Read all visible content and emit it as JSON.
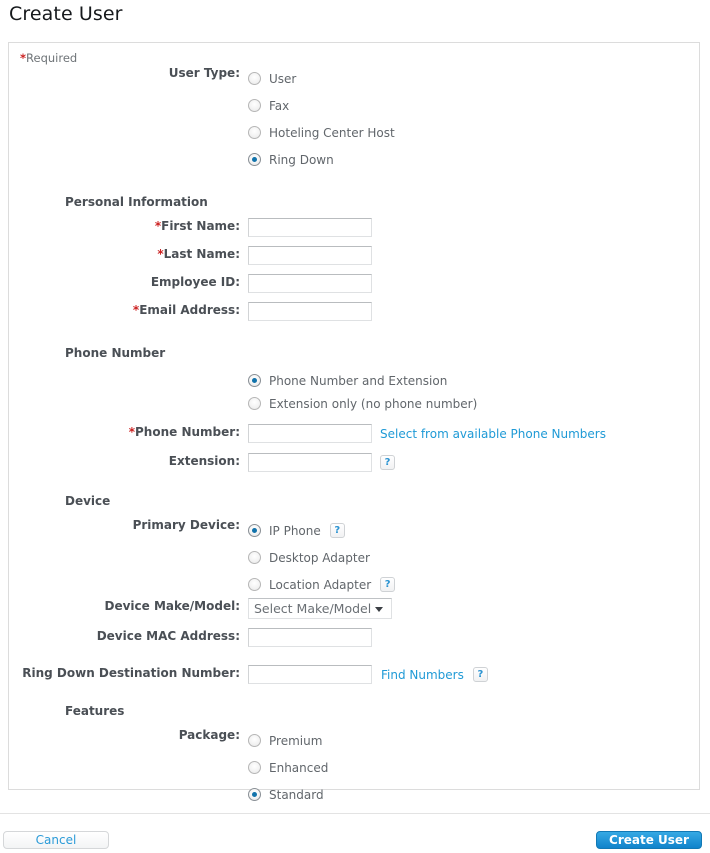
{
  "page": {
    "title": "Create User",
    "required_note_star": "*",
    "required_note_text": "Required"
  },
  "form": {
    "user_type": {
      "label": "User Type:",
      "options": [
        {
          "label": "User",
          "selected": false
        },
        {
          "label": "Fax",
          "selected": false
        },
        {
          "label": "Hoteling Center Host",
          "selected": false
        },
        {
          "label": "Ring Down",
          "selected": true
        }
      ]
    },
    "personal_information": {
      "heading": "Personal Information",
      "first_name": {
        "label": "First Name:",
        "required": true,
        "value": ""
      },
      "last_name": {
        "label": "Last Name:",
        "required": true,
        "value": ""
      },
      "employee_id": {
        "label": "Employee ID:",
        "required": false,
        "value": ""
      },
      "email_address": {
        "label": "Email Address:",
        "required": true,
        "value": ""
      }
    },
    "phone_number": {
      "heading": "Phone Number",
      "mode_options": [
        {
          "label": "Phone Number and Extension",
          "selected": true
        },
        {
          "label": "Extension only (no phone number)",
          "selected": false
        }
      ],
      "phone_number": {
        "label": "Phone Number:",
        "required": true,
        "value": ""
      },
      "select_link": "Select from available Phone Numbers",
      "extension": {
        "label": "Extension:",
        "required": false,
        "value": ""
      },
      "extension_help": "?"
    },
    "device": {
      "heading": "Device",
      "primary_device": {
        "label": "Primary Device:",
        "options": [
          {
            "label": "IP Phone",
            "selected": true,
            "help": "?"
          },
          {
            "label": "Desktop Adapter",
            "selected": false,
            "help": ""
          },
          {
            "label": "Location Adapter",
            "selected": false,
            "help": "?"
          }
        ]
      },
      "make_model": {
        "label": "Device Make/Model:",
        "value": "Select Make/Model"
      },
      "mac_address": {
        "label": "Device MAC Address:",
        "value": ""
      },
      "ring_down_destination": {
        "label": "Ring Down Destination Number:",
        "value": "",
        "link": "Find Numbers",
        "help": "?"
      }
    },
    "features": {
      "heading": "Features",
      "package": {
        "label": "Package:",
        "options": [
          {
            "label": "Premium",
            "selected": false
          },
          {
            "label": "Enhanced",
            "selected": false
          },
          {
            "label": "Standard",
            "selected": true
          }
        ]
      }
    }
  },
  "footer": {
    "cancel_label": "Cancel",
    "submit_label": "Create User"
  },
  "colors": {
    "link": "#1f9ad6",
    "primary_button": "#1083cb",
    "required_star": "#cc2222",
    "radio_dot": "#1273ab"
  }
}
